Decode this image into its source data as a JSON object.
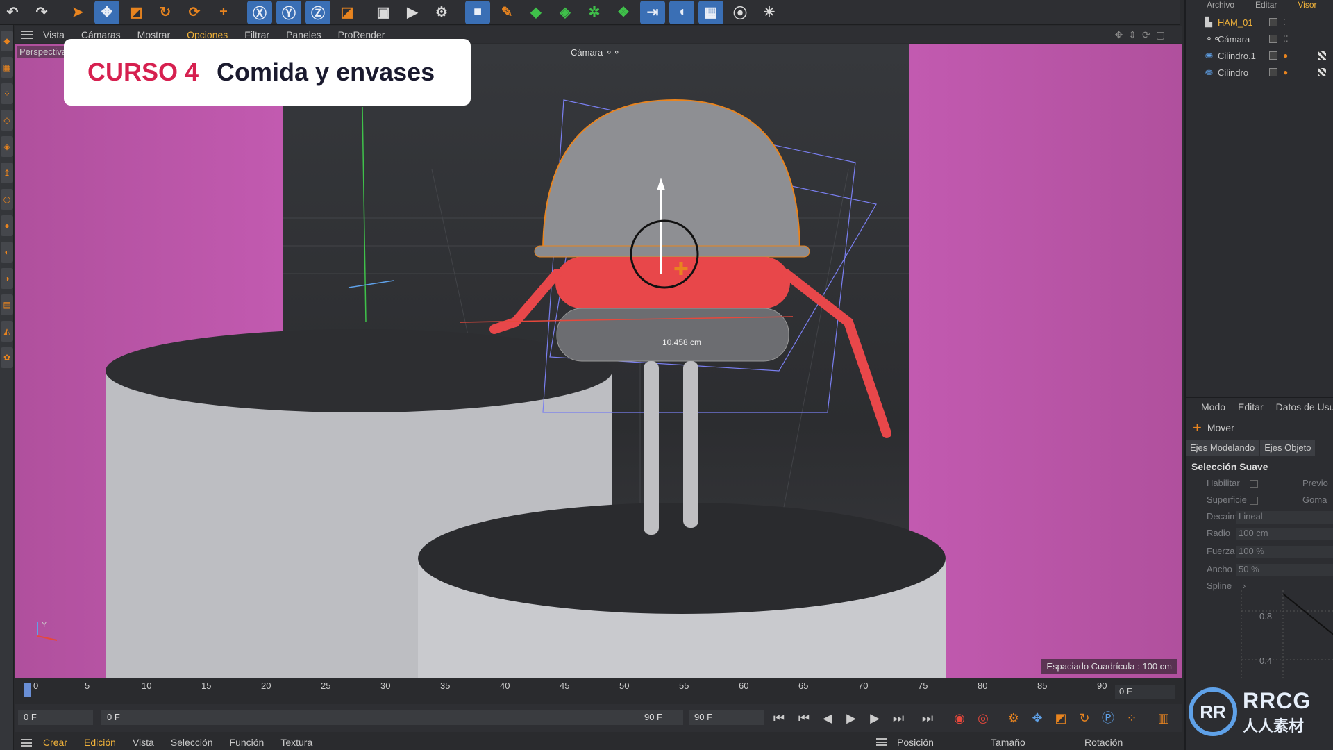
{
  "banner": {
    "course": "CURSO 4",
    "title": "Comida y envases"
  },
  "viewport_menu": {
    "items": [
      "Vista",
      "Cámaras",
      "Mostrar",
      "Opciones",
      "Filtrar",
      "Paneles",
      "ProRender"
    ],
    "active": "Opciones"
  },
  "viewport": {
    "view_label": "Perspectiva",
    "camera_label": "Cámara",
    "measure_label": "10.458 cm",
    "grid_info": "Espaciado Cuadrícula : 100 cm",
    "axis_label": "Y"
  },
  "object_manager": {
    "menu": [
      "Archivo",
      "Editar",
      "Visor"
    ],
    "objects": [
      {
        "name": "HAM_01",
        "icon": "layer-icon",
        "selected": true
      },
      {
        "name": "Cámara",
        "icon": "camera-icon",
        "selected": false
      },
      {
        "name": "Cilindro.1",
        "icon": "cylinder-icon",
        "selected": false
      },
      {
        "name": "Cilindro",
        "icon": "cylinder-icon",
        "selected": false
      }
    ]
  },
  "attributes": {
    "menu": [
      "Modo",
      "Editar",
      "Datos de Usuario"
    ],
    "tool": "Mover",
    "tabs": [
      "Ejes Modelando",
      "Ejes Objeto"
    ],
    "section": "Selección Suave",
    "rows": [
      {
        "label": "Habilitar",
        "value": "",
        "right": "Previo"
      },
      {
        "label": "Superficie",
        "value": "",
        "right": "Goma"
      },
      {
        "label": "Decaimiento",
        "value": "Lineal",
        "right": ""
      },
      {
        "label": "Radio",
        "value": "100 cm",
        "right": ""
      },
      {
        "label": "Fuerza",
        "value": "100 %",
        "right": ""
      },
      {
        "label": "Ancho",
        "value": "50 %",
        "right": ""
      },
      {
        "label": "Spline",
        "value": "",
        "right": ""
      }
    ],
    "graph_labels": [
      "0.8",
      "0.4"
    ]
  },
  "timeline": {
    "ticks": [
      "0",
      "5",
      "10",
      "15",
      "20",
      "25",
      "30",
      "35",
      "40",
      "45",
      "50",
      "55",
      "60",
      "65",
      "70",
      "75",
      "80",
      "85",
      "90"
    ],
    "current_frame_display": "0 F"
  },
  "transport": {
    "start": "0 F",
    "current": "0 F",
    "end": "90 F",
    "max": "90 F"
  },
  "bottom_menu": {
    "items": [
      "Crear",
      "Edición",
      "Vista",
      "Selección",
      "Función",
      "Textura"
    ],
    "highlighted": [
      "Crear",
      "Edición"
    ]
  },
  "coords": {
    "labels": [
      "Posición",
      "Tamaño",
      "Rotación"
    ]
  },
  "watermark": {
    "logo": "RR",
    "brand": "RRCG",
    "sub": "人人素材"
  },
  "colors": {
    "accent": "#f0b23a",
    "banner_red": "#d6204f",
    "magenta": "#c25ab0",
    "tool_orange": "#e8841f",
    "axis_blue": "#5fa1e8"
  }
}
